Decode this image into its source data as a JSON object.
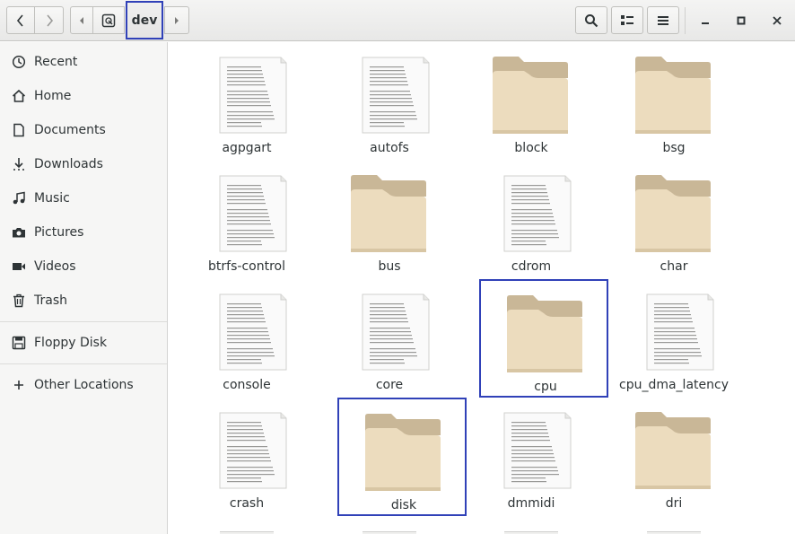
{
  "header": {
    "path_label": "dev",
    "buttons": {
      "back": "back",
      "forward": "forward",
      "crumb_left": "previous path",
      "crumb_right": "next path",
      "search": "search",
      "view": "view options",
      "menu": "menu",
      "minimize": "minimize",
      "maximize": "maximize",
      "close": "close"
    }
  },
  "sidebar": {
    "items": [
      {
        "label": "Recent",
        "icon": "clock-icon"
      },
      {
        "label": "Home",
        "icon": "home-icon"
      },
      {
        "label": "Documents",
        "icon": "document-icon"
      },
      {
        "label": "Downloads",
        "icon": "download-icon"
      },
      {
        "label": "Music",
        "icon": "music-icon"
      },
      {
        "label": "Pictures",
        "icon": "camera-icon"
      },
      {
        "label": "Videos",
        "icon": "video-icon"
      },
      {
        "label": "Trash",
        "icon": "trash-icon"
      },
      {
        "label": "Floppy Disk",
        "icon": "floppy-icon"
      },
      {
        "label": "Other Locations",
        "icon": "plus-icon"
      }
    ]
  },
  "files": [
    {
      "name": "agpgart",
      "type": "file"
    },
    {
      "name": "autofs",
      "type": "file"
    },
    {
      "name": "block",
      "type": "folder"
    },
    {
      "name": "bsg",
      "type": "folder"
    },
    {
      "name": "btrfs-control",
      "type": "file"
    },
    {
      "name": "bus",
      "type": "folder"
    },
    {
      "name": "cdrom",
      "type": "file"
    },
    {
      "name": "char",
      "type": "folder"
    },
    {
      "name": "console",
      "type": "file"
    },
    {
      "name": "core",
      "type": "file"
    },
    {
      "name": "cpu",
      "type": "folder"
    },
    {
      "name": "cpu_dma_latency",
      "type": "file"
    },
    {
      "name": "crash",
      "type": "file"
    },
    {
      "name": "disk",
      "type": "folder"
    },
    {
      "name": "dmmidi",
      "type": "file"
    },
    {
      "name": "dri",
      "type": "folder"
    }
  ],
  "colors": {
    "selection": "#3041b8",
    "folder_back": "#c9b797",
    "folder_front": "#ecdcbe"
  }
}
